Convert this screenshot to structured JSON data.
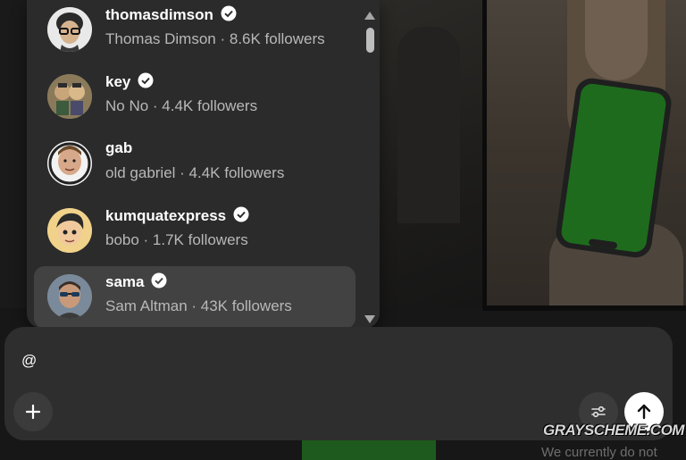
{
  "mention_dropdown": {
    "items": [
      {
        "username": "thomasdimson",
        "verified": true,
        "display_name": "Thomas Dimson",
        "followers": "8.6K followers",
        "subtitle": "Thomas Dimson · 8.6K followers",
        "avatar_icon": "avatar-thomasdimson"
      },
      {
        "username": "key",
        "verified": true,
        "display_name": "No No",
        "followers": "4.4K followers",
        "subtitle": "No No · 4.4K followers",
        "avatar_icon": "avatar-key"
      },
      {
        "username": "gab",
        "verified": false,
        "display_name": "old gabriel",
        "followers": "4.4K followers",
        "subtitle": "old gabriel · 4.4K followers",
        "avatar_icon": "avatar-gab"
      },
      {
        "username": "kumquatexpress",
        "verified": true,
        "display_name": "bobo",
        "followers": "1.7K followers",
        "subtitle": "bobo · 1.7K followers",
        "avatar_icon": "avatar-kumquatexpress"
      },
      {
        "username": "sama",
        "verified": true,
        "display_name": "Sam Altman",
        "followers": "43K followers",
        "subtitle": "Sam Altman · 43K followers",
        "avatar_icon": "avatar-sama",
        "selected": true
      }
    ]
  },
  "composer": {
    "text": "@",
    "add_icon": "plus-icon",
    "settings_icon": "sliders-icon",
    "send_icon": "arrow-up-icon"
  },
  "watermark": "GRAYSCHEME.COM",
  "background_caption": "We currently do not",
  "colors": {
    "dropdown_bg": "#2b2b2b",
    "selected_row_bg": "#424242",
    "composer_bg": "#2e2e2e",
    "send_button_bg": "#ffffff"
  }
}
